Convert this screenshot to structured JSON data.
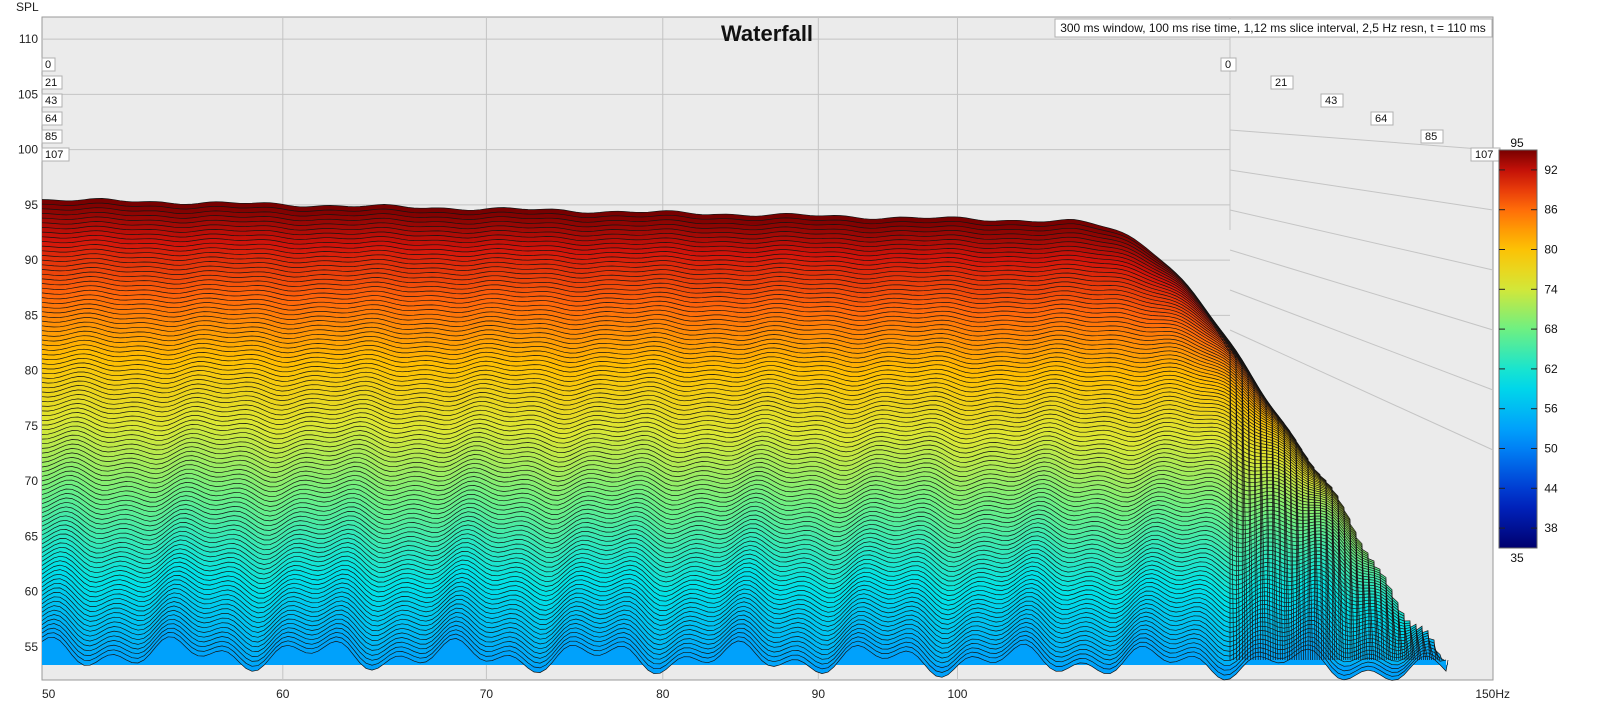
{
  "chart_data": {
    "type": "waterfall",
    "title": "Waterfall",
    "info": "300 ms window, 100 ms rise time, 1,12 ms slice interval, 2,5 Hz resn, t = 110 ms",
    "ylabel": "SPL",
    "xunit": "Hz",
    "ylim": [
      52,
      112
    ],
    "xlim": [
      50,
      150
    ],
    "x_scale": "log",
    "y_ticks": [
      "110",
      "105",
      "100",
      "95",
      "90",
      "85",
      "80",
      "75",
      "70",
      "65",
      "60",
      "55"
    ],
    "x_ticks": [
      "50",
      "60",
      "70",
      "80",
      "90",
      "100",
      "150Hz"
    ],
    "time_ticks": [
      "0",
      "21",
      "43",
      "64",
      "85",
      "107"
    ],
    "time_unit": "ms",
    "colorbar": {
      "min": "35",
      "max": "95",
      "ticks": [
        "92",
        "86",
        "80",
        "74",
        "68",
        "62",
        "56",
        "50",
        "44",
        "38"
      ]
    },
    "front_slice_spl_approx": [
      {
        "hz": 50,
        "spl": 95.5
      },
      {
        "hz": 70,
        "spl": 94.5
      },
      {
        "hz": 100,
        "spl": 93.5
      },
      {
        "hz": 125,
        "spl": 93
      }
    ],
    "slice_count_visible": 98
  },
  "colors": {
    "background": "#ffffff",
    "plot_bg": "#ebebeb",
    "grid": "#c4c4c4",
    "slice_line": "#141414"
  }
}
